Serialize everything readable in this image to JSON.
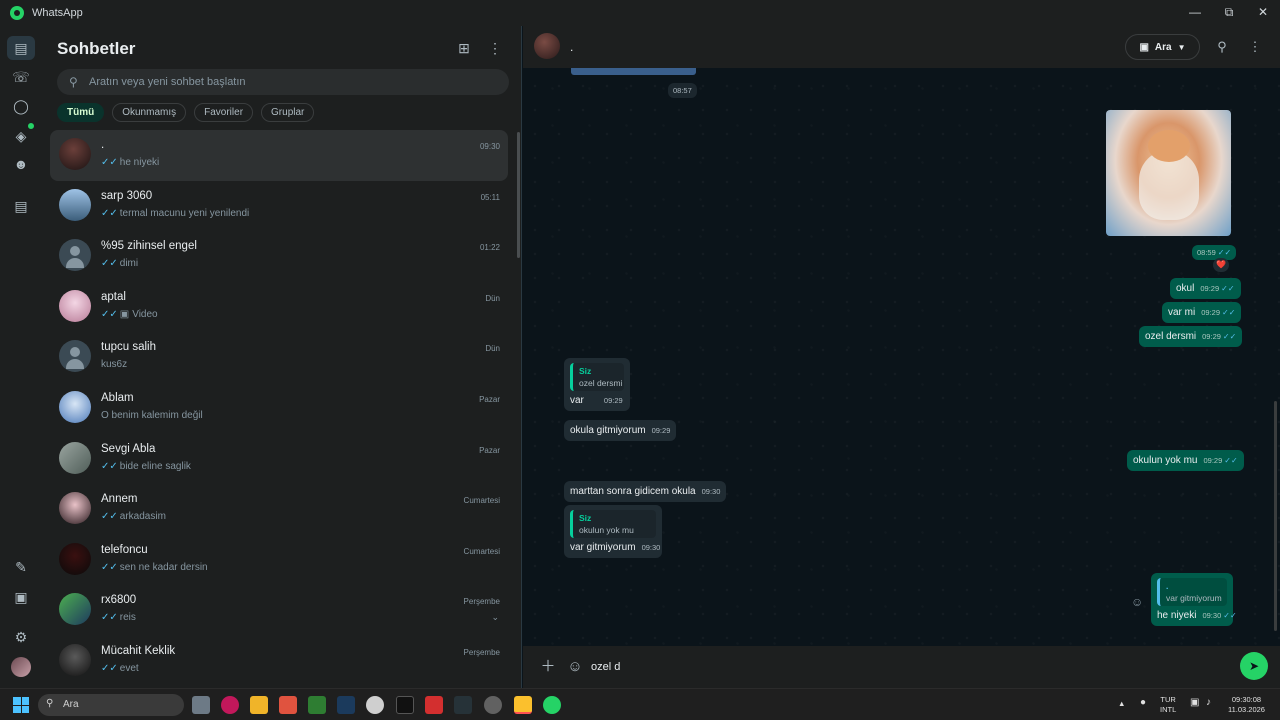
{
  "window": {
    "title": "WhatsApp"
  },
  "sidebar": {
    "title": "Sohbetler",
    "search_placeholder": "Aratın veya yeni sohbet başlatın",
    "filters": [
      "Tümü",
      "Okunmamış",
      "Favoriler",
      "Gruplar"
    ],
    "chats": [
      {
        "name": ".",
        "preview": "he niyeki",
        "time": "09:30",
        "read": true,
        "avatar": "photo-dark"
      },
      {
        "name": "sarp 3060",
        "preview": "termal macunu yeni yenilendi",
        "time": "05:11",
        "read": true,
        "avatar": "photo-sky"
      },
      {
        "name": "%95 zihinsel engel",
        "preview": "dimi",
        "time": "01:22",
        "read": true,
        "avatar": "default"
      },
      {
        "name": "aptal",
        "preview": "Video",
        "time": "Dün",
        "read": true,
        "avatar": "photo-pink",
        "media": "video-icon"
      },
      {
        "name": "tupcu salih",
        "preview": "kus6z",
        "time": "Dün",
        "read": false,
        "avatar": "default"
      },
      {
        "name": "Ablam",
        "preview": "O benim kalemim değil",
        "time": "Pazar",
        "read": false,
        "avatar": "photo-blue"
      },
      {
        "name": "Sevgi Abla",
        "preview": "bide eline saglik",
        "time": "Pazar",
        "read": true,
        "avatar": "photo-grey"
      },
      {
        "name": "Annem",
        "preview": "arkadasim",
        "time": "Cumartesi",
        "read": true,
        "avatar": "photo-rose"
      },
      {
        "name": "telefoncu",
        "preview": "sen ne kadar dersin",
        "time": "Cumartesi",
        "read": true,
        "avatar": "photo-red"
      },
      {
        "name": "rx6800",
        "preview": "reis",
        "time": "Perşembe",
        "read": true,
        "avatar": "photo-green"
      },
      {
        "name": "Mücahit Keklik",
        "preview": "evet",
        "time": "Perşembe",
        "read": true,
        "avatar": "photo-black"
      }
    ]
  },
  "chat": {
    "contact_name": ".",
    "call_label": "Ara",
    "messages": {
      "m0_time": "08:57",
      "m1_time": "08:59",
      "m1_reaction": "❤️",
      "m2_text": "okul",
      "m2_time": "09:29",
      "m3_text": "var mi",
      "m3_time": "09:29",
      "m4_text": "ozel dersmi",
      "m4_time": "09:29",
      "m5_quote_name": "Siz",
      "m5_quote_text": "ozel dersmi",
      "m5_text": "var",
      "m5_time": "09:29",
      "m6_text": "okula gitmiyorum",
      "m6_time": "09:29",
      "m7_text": "okulun yok mu",
      "m7_time": "09:29",
      "m8_text": "marttan sonra gidicem okula",
      "m8_time": "09:30",
      "m9_quote_name": "Siz",
      "m9_quote_text": "okulun yok mu",
      "m9_text": "var gitmiyorum",
      "m9_time": "09:30",
      "m10_quote_name": ".",
      "m10_quote_text": "var gitmiyorum",
      "m10_text": "he niyeki",
      "m10_time": "09:30"
    },
    "composer_value": "ozel d"
  },
  "taskbar": {
    "search_label": "Ara",
    "lang_top": "TUR",
    "lang_bottom": "INTL",
    "clock_time": "09:30:08",
    "clock_date": "11.03.2026"
  },
  "colors": {
    "accent": "#25d366",
    "outgoing_bubble": "#005c4b",
    "incoming_bubble": "#202c33",
    "read_tick": "#53bdeb"
  }
}
